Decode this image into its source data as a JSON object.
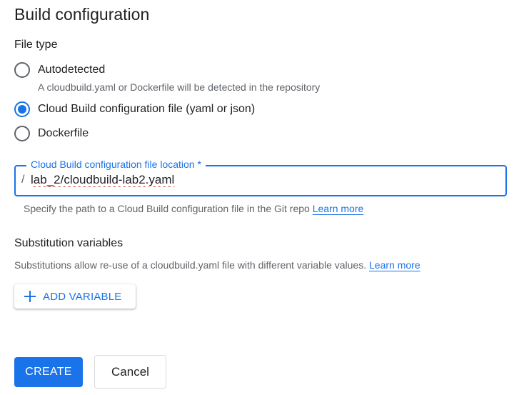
{
  "page": {
    "title": "Build configuration"
  },
  "file_type": {
    "label": "File type",
    "options": [
      {
        "label": "Autodetected",
        "help": "A cloudbuild.yaml or Dockerfile will be detected in the repository",
        "selected": false
      },
      {
        "label": "Cloud Build configuration file (yaml or json)",
        "selected": true
      },
      {
        "label": "Dockerfile",
        "selected": false
      }
    ]
  },
  "config_location": {
    "label": "Cloud Build configuration file location *",
    "prefix": "/",
    "value": "lab_2/cloudbuild-lab2.yaml",
    "help": "Specify the path to a Cloud Build configuration file in the Git repo",
    "learn_more": "Learn more"
  },
  "substitutions": {
    "title": "Substitution variables",
    "help": "Substitutions allow re-use of a cloudbuild.yaml file with different variable values.",
    "learn_more": "Learn more",
    "add_button": "ADD VARIABLE",
    "add_icon": "plus-icon"
  },
  "actions": {
    "create": "CREATE",
    "cancel": "Cancel"
  },
  "colors": {
    "accent": "#1a73e8",
    "text": "#202124",
    "secondary_text": "#5f6368"
  }
}
